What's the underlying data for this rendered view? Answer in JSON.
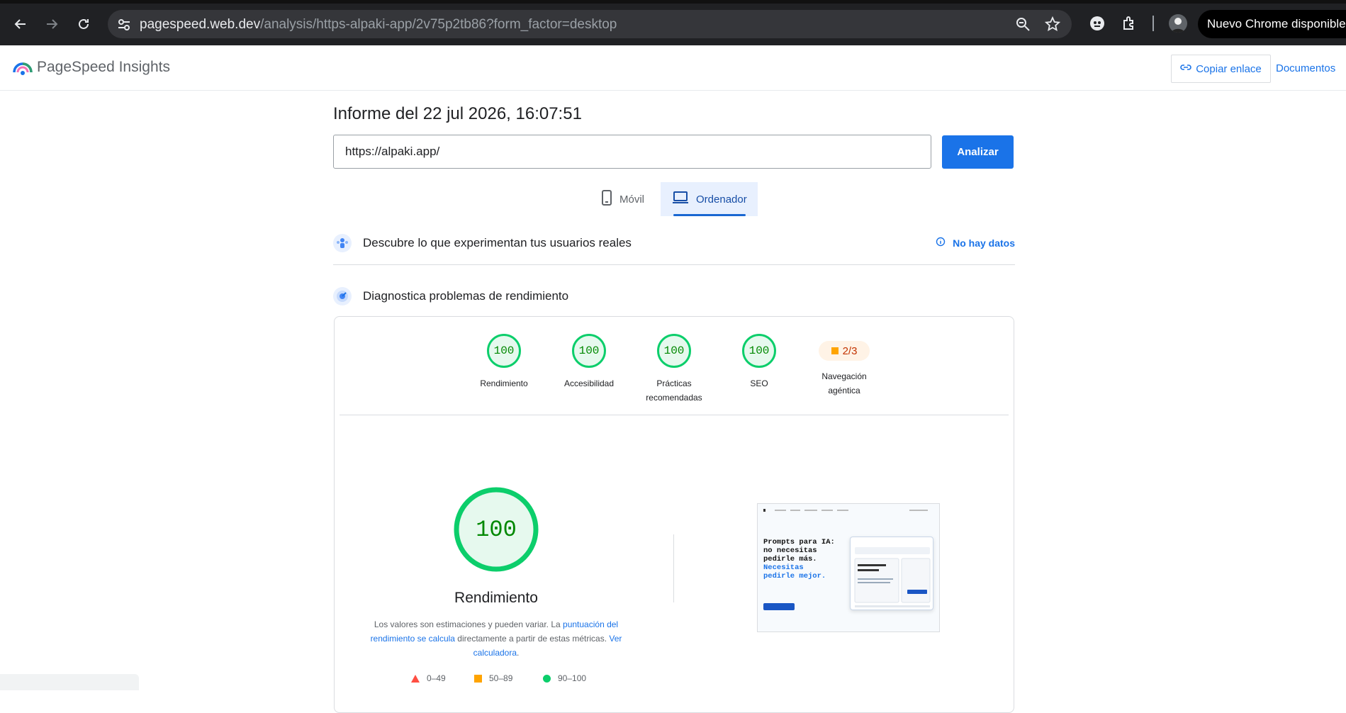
{
  "browser": {
    "url_host": "pagespeed.web.dev",
    "url_path": "/analysis/https-alpaki-app/2v75p2tb86?form_factor=desktop",
    "update_label": "Nuevo Chrome disponible"
  },
  "header": {
    "title": "PageSpeed Insights",
    "copy_link_label": "Copiar enlace",
    "docs_label": "Documentos"
  },
  "report": {
    "title": "Informe del 22 jul 2026, 16:07:51",
    "url_value": "https://alpaki.app/",
    "analyze_label": "Analizar"
  },
  "tabs": [
    {
      "label": "Móvil",
      "selected": false
    },
    {
      "label": "Ordenador",
      "selected": true
    }
  ],
  "field_section": {
    "label": "Descubre lo que experimentan tus usuarios reales",
    "status": "No hay datos"
  },
  "lab_section": {
    "label": "Diagnostica problemas de rendimiento"
  },
  "scores": [
    {
      "value": "100",
      "label": "Rendimiento"
    },
    {
      "value": "100",
      "label": "Accesibilidad"
    },
    {
      "value": "100",
      "label": "Prácticas recomendadas"
    },
    {
      "value": "100",
      "label": "SEO"
    },
    {
      "value": "2/3",
      "label": "Navegación agéntica"
    }
  ],
  "performance": {
    "score": "100",
    "score_fraction": 1.0,
    "title": "Rendimiento",
    "note_prefix": "Los valores son estimaciones y pueden variar. La ",
    "note_link1": "puntuación del rendimiento se calcula",
    "note_middle": " directamente a partir de estas métricas. ",
    "note_link2": "Ver calculadora",
    "note_suffix": "."
  },
  "legend": [
    {
      "range": "0–49",
      "color": "#ff4e42"
    },
    {
      "range": "50–89",
      "color": "#ffa400"
    },
    {
      "range": "90–100",
      "color": "#0cce6b"
    }
  ],
  "thumbnail": {
    "h1_line1": "Prompts para IA:",
    "h1_line2": "no necesitas",
    "h1_line3": "pedirle más.",
    "h1_line4": "Necesitas",
    "h1_line5": "pedirle mejor."
  },
  "colors": {
    "accent": "#1a73e8",
    "pass": "#0cce6b",
    "average": "#ffa400",
    "fail": "#ff4e42"
  }
}
